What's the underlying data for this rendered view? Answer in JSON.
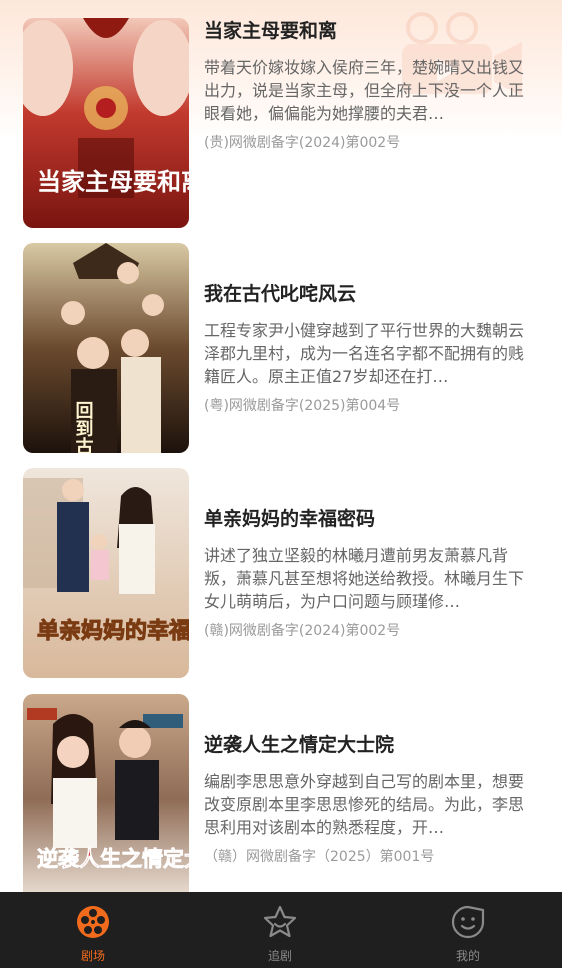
{
  "dramas": [
    {
      "title": "当家主母要和离",
      "description": "带着天价嫁妆嫁入侯府三年，楚婉晴又出钱又出力，说是当家主母，但全府上下没一个人正眼看她，偏偏能为她撑腰的夫君…",
      "license": "(贵)网微剧备字(2024)第002号",
      "cover_text": "当家主母要和离"
    },
    {
      "title": "我在古代叱咤风云",
      "description": "工程专家尹小健穿越到了平行世界的大魏朝云泽郡九里村，成为一名连名字都不配拥有的贱籍匠人。原主正值27岁却还在打…",
      "license": "(粤)网微剧备字(2025)第004号",
      "cover_text": "回到古代领我去当家"
    },
    {
      "title": "单亲妈妈的幸福密码",
      "description": "讲述了独立坚毅的林曦月遭前男友萧慕凡背叛，萧慕凡甚至想将她送给教授。林曦月生下女儿萌萌后，为户口问题与顾瑾修…",
      "license": "(赣)网微剧备字(2024)第002号",
      "cover_text": "单亲妈妈的幸福密码"
    },
    {
      "title": "逆袭人生之情定大士院",
      "description": "编剧李思思意外穿越到自己写的剧本里，想要改变原剧本里李思思惨死的结局。为此，李思思利用对该剧本的熟悉程度，开…",
      "license": "（赣）网微剧备字（2025）第001号",
      "cover_text": "逆袭人生之情定大士院"
    }
  ],
  "tabs": [
    {
      "label": "剧场",
      "icon": "film-reel-icon",
      "active": true
    },
    {
      "label": "追剧",
      "icon": "star-icon",
      "active": false
    },
    {
      "label": "我的",
      "icon": "smiley-icon",
      "active": false
    }
  ],
  "colors": {
    "accent": "#f26b1d",
    "tabbar_bg": "#1f1f1f",
    "title": "#222222",
    "desc": "#666666"
  }
}
